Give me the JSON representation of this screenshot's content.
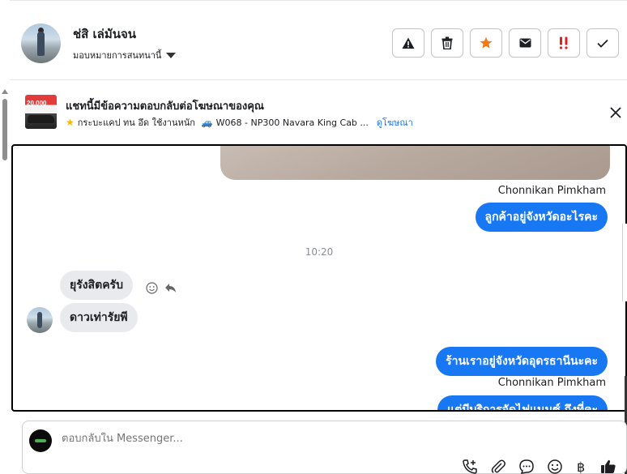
{
  "header": {
    "contact_name": "ช่สิ เล่มันจน",
    "assign_label": "มอบหมายการสนทนานี้",
    "actions": [
      {
        "name": "report-button",
        "icon": "warning-icon"
      },
      {
        "name": "delete-button",
        "icon": "trash-icon"
      },
      {
        "name": "star-button",
        "icon": "star-icon"
      },
      {
        "name": "mark-unread-button",
        "icon": "envelope-icon"
      },
      {
        "name": "spam-button",
        "icon": "spam-icon"
      },
      {
        "name": "done-button",
        "icon": "check-icon"
      }
    ],
    "colors": {
      "star": "#f07a1a",
      "spam": "#e02020"
    }
  },
  "ad_banner": {
    "thumb_text": "20,000",
    "title": "แชทนี้มีข้อความตอบกลับต่อโฆษณาของคุณ",
    "subtitle": "กระบะแคป ทน อึด ใช้งานหนัก",
    "ad_code": "W068 - NP300 Navara King Cab ...",
    "view_ad_link": "ดูโฆษณา"
  },
  "messages": {
    "sender_name_1": "Chonnikan Pimkham",
    "out_1": "ลูกค้าอยู่จังหวัดอะไรคะ",
    "timestamp": "10:20",
    "in_1": "ยุรังสิตครับ",
    "in_2": "ดาวเท่ารัยพี",
    "out_2": "ร้านเราอยู่จังหวัดอุดรธานีนะคะ",
    "sender_name_2": "Chonnikan Pimkham",
    "out_3": "แต่มีบริการจัดไฟแนนซ์ ถึงที่คะ"
  },
  "composer": {
    "placeholder": "ตอบกลับใน Messenger...",
    "tools": [
      "call-add-icon",
      "paperclip-icon",
      "quick-reply-icon",
      "emoji-icon",
      "baht-icon",
      "thumbs-up-icon"
    ]
  },
  "accent_color": "#1877f2"
}
